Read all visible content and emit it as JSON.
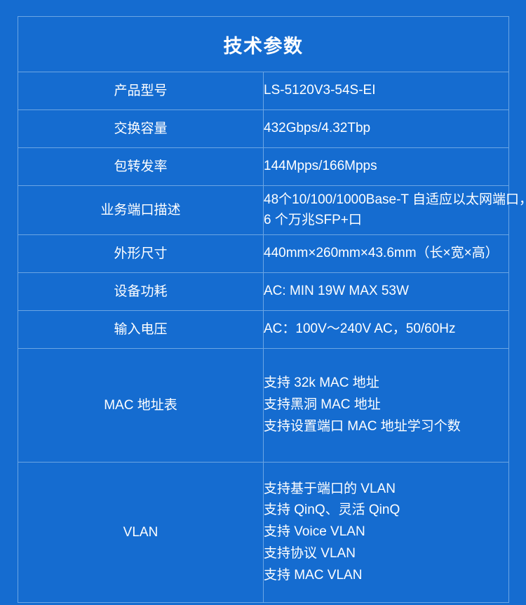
{
  "header": {
    "title": "技术参数"
  },
  "table": {
    "rows": [
      {
        "label": "产品型号",
        "lines": [
          "LS-5120V3-54S-EI"
        ],
        "size": "single"
      },
      {
        "label": "交换容量",
        "lines": [
          "432Gbps/4.32Tbp"
        ],
        "size": "single"
      },
      {
        "label": "包转发率",
        "lines": [
          "144Mpps/166Mpps"
        ],
        "size": "single"
      },
      {
        "label": "业务端口描述",
        "lines": [
          "48个10/100/1000Base-T 自适应以太网端口，",
          "6 个万兆SFP+口"
        ],
        "size": "double"
      },
      {
        "label": "外形尺寸",
        "lines": [
          "440mm×260mm×43.6mm（长×宽×高）"
        ],
        "size": "single"
      },
      {
        "label": "设备功耗",
        "lines": [
          "AC: MIN 19W MAX 53W"
        ],
        "size": "single"
      },
      {
        "label": "输入电压",
        "lines": [
          "AC：100V～240V AC，50/60Hz"
        ],
        "size": "single"
      },
      {
        "label": "MAC 地址表",
        "lines": [
          "支持 32k MAC 地址",
          "支持黑洞 MAC 地址",
          "支持设置端口 MAC 地址学习个数"
        ],
        "size": "mac"
      },
      {
        "label": "VLAN",
        "lines": [
          "支持基于端口的 VLAN",
          "支持 QinQ、灵活 QinQ",
          "支持 Voice VLAN",
          "支持协议 VLAN",
          "支持 MAC VLAN"
        ],
        "size": "vlan"
      }
    ]
  },
  "colors": {
    "background": "#156cd0",
    "border": "#6ba5e3",
    "text": "#ffffff"
  }
}
